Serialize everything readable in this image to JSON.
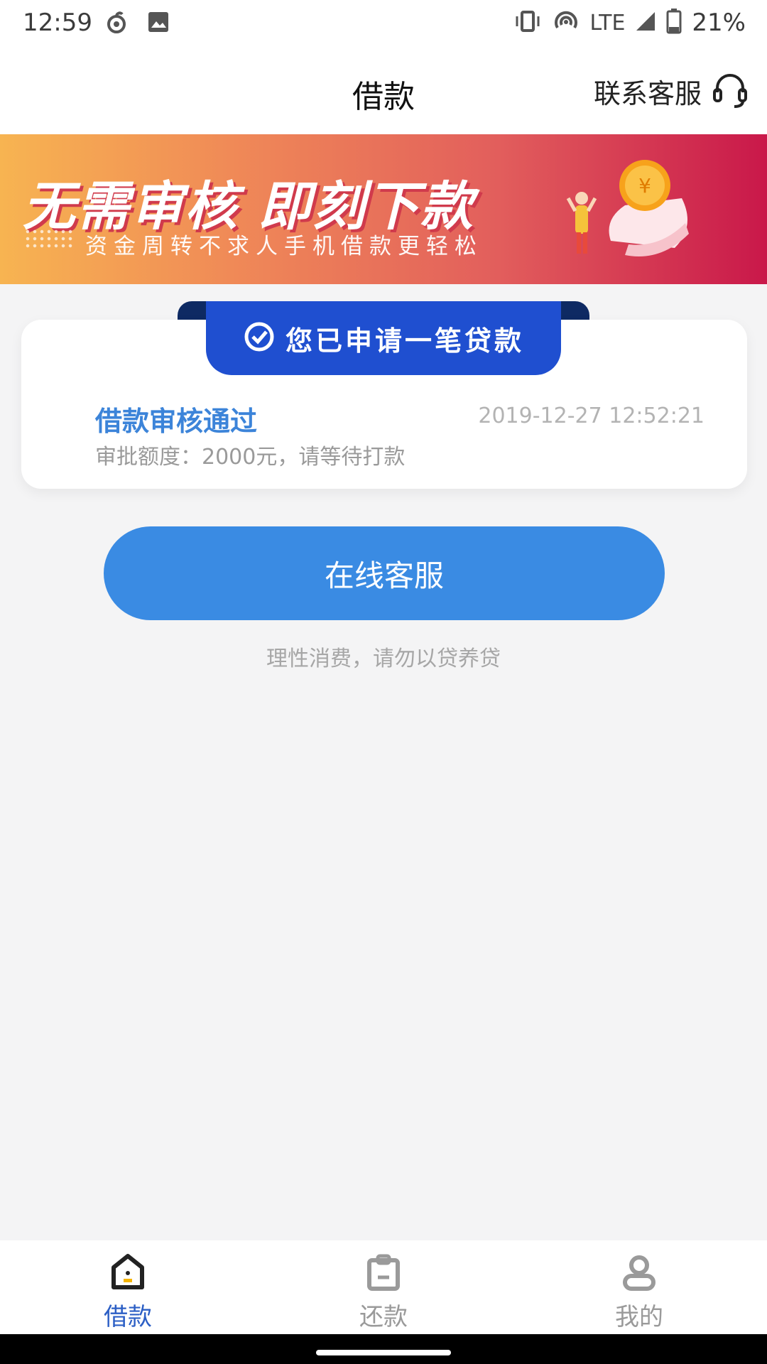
{
  "status_bar": {
    "time": "12:59",
    "network": "LTE",
    "battery": "21%"
  },
  "header": {
    "title": "借款",
    "contact_label": "联系客服"
  },
  "banner": {
    "headline": "无需审核  即刻下款",
    "subline": "资金周转不求人手机借款更轻松"
  },
  "card": {
    "ribbon_text": "您已申请一笔贷款",
    "status": "借款审核通过",
    "datetime": "2019-12-27 12:52:21",
    "amount_text": "审批额度：2000元，请等待打款"
  },
  "actions": {
    "service_button": "在线客服",
    "notice": "理性消费，请勿以贷养贷"
  },
  "bottom_nav": {
    "items": [
      {
        "label": "借款",
        "icon": "home-icon",
        "active": true
      },
      {
        "label": "还款",
        "icon": "clipboard-icon",
        "active": false
      },
      {
        "label": "我的",
        "icon": "user-icon",
        "active": false
      }
    ]
  },
  "colors": {
    "accent": "#3a8be3",
    "ribbon": "#1f4fd0",
    "status_text": "#3c84d9",
    "active_nav": "#2c5fc5"
  }
}
